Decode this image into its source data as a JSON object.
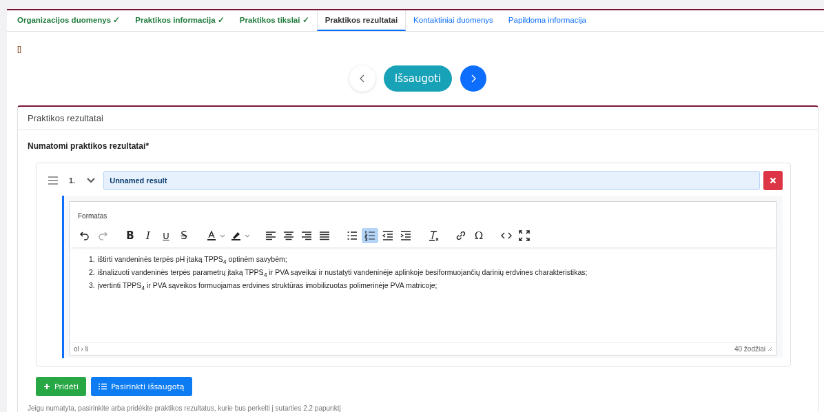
{
  "tabs": [
    {
      "label": "Organizacijos duomenys",
      "check": "✓",
      "completed": true,
      "selected": false
    },
    {
      "label": "Praktikos informacija",
      "check": "✓",
      "completed": true,
      "selected": false
    },
    {
      "label": "Praktikos tikslai",
      "check": "✓",
      "completed": true,
      "selected": false
    },
    {
      "label": "Praktikos rezultatai",
      "completed": false,
      "selected": true
    },
    {
      "label": "Kontaktiniai duomenys",
      "completed": false,
      "selected": false
    },
    {
      "label": "Papildoma informacija",
      "completed": false,
      "selected": false
    }
  ],
  "debug_text": "[]",
  "nav": {
    "save_label": "Išsaugoti"
  },
  "section": {
    "title": "Praktikos rezultatai",
    "field_label": "Numatomi praktikos rezultatai*",
    "results": [
      {
        "number": "1.",
        "expanded": true,
        "name": "Unnamed result",
        "editor": {
          "menu_label": "Formatas",
          "toolbar": [
            {
              "kind": "undo",
              "on": false,
              "disabled": false
            },
            {
              "kind": "redo",
              "on": false,
              "disabled": true
            },
            {
              "kind": "sep"
            },
            {
              "kind": "bold",
              "glyph": "B",
              "on": false
            },
            {
              "kind": "italic",
              "glyph": "I",
              "on": false
            },
            {
              "kind": "underline",
              "glyph": "U",
              "on": false
            },
            {
              "kind": "strike",
              "glyph": "S",
              "on": false
            },
            {
              "kind": "sep"
            },
            {
              "kind": "text-color",
              "on": false
            },
            {
              "kind": "highlight",
              "on": false
            },
            {
              "kind": "sep"
            },
            {
              "kind": "align-left",
              "on": false
            },
            {
              "kind": "align-center",
              "on": false
            },
            {
              "kind": "align-right",
              "on": false
            },
            {
              "kind": "justify",
              "on": false
            },
            {
              "kind": "sep"
            },
            {
              "kind": "bullet-list",
              "on": false
            },
            {
              "kind": "numbered-list",
              "on": true
            },
            {
              "kind": "outdent",
              "on": false
            },
            {
              "kind": "indent",
              "on": false
            },
            {
              "kind": "sep"
            },
            {
              "kind": "clear-format",
              "on": false
            },
            {
              "kind": "sep"
            },
            {
              "kind": "link",
              "on": false
            },
            {
              "kind": "special-char",
              "glyph": "Ω",
              "on": false
            },
            {
              "kind": "sep"
            },
            {
              "kind": "code",
              "on": false
            },
            {
              "kind": "fullscreen",
              "on": false
            }
          ],
          "items": [
            {
              "number": "1.",
              "text": "ištirti vandeninės terpės pH įtaką TPPS$_{4}$ optinėm savybėm;"
            },
            {
              "number": "2.",
              "text": "išnalizuoti vandeninės terpės parametrų įtaką TPPS$_{4}$ ir PVA sąveikai ir nustatyti vandeninėje aplinkoje besiformuojančių darinių erdvines charakteristikas;"
            },
            {
              "number": "3.",
              "text": "įvertinti TPPS$_{4}$ ir PVA sąveikos formuojamas erdvines struktūras imobilizuotas polimerinėje PVA matricoje;"
            }
          ],
          "path": "ol › li",
          "word_count": "40 žodžiai"
        }
      }
    ],
    "add_label": "Pridėti",
    "choose_label": "Pasirinkti išsaugotą",
    "hint": "Jeigu numatyta, pasirinkite arba pridėkite praktikos rezultatus, kurie bus perkelti į sutarties 2.2 papunktį"
  }
}
